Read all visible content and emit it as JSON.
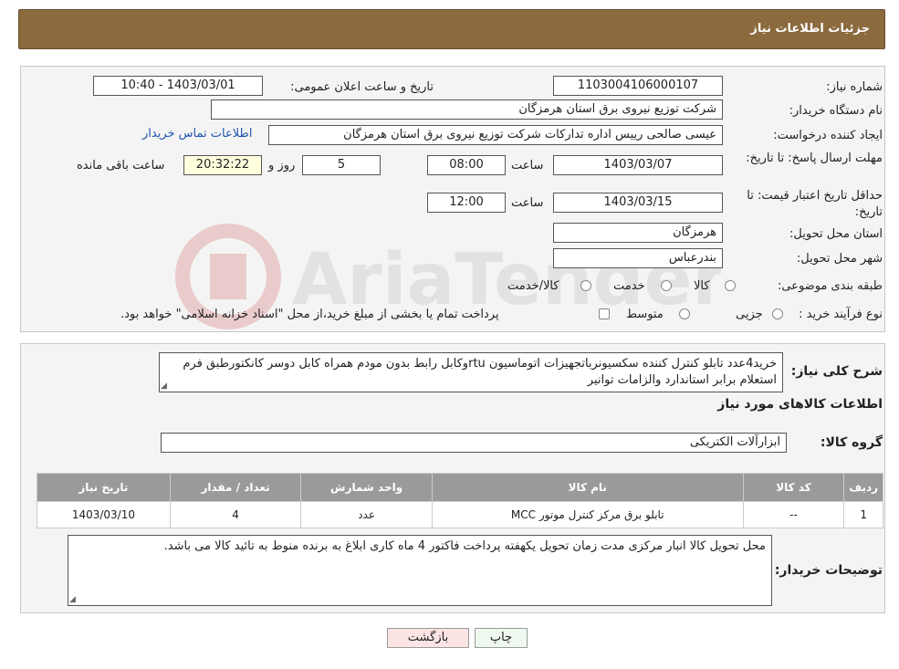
{
  "header": {
    "title": "جزئیات اطلاعات نیاز"
  },
  "form": {
    "need_number": {
      "label": "شماره نیاز:",
      "value": "1103004106000107"
    },
    "announce_datetime": {
      "label": "تاریخ و ساعت اعلان عمومی:",
      "value": "1403/03/01 - 10:40"
    },
    "buyer_org": {
      "label": "نام دستگاه خریدار:",
      "value": "شرکت توزیع نیروی برق استان هرمزگان"
    },
    "requester": {
      "label": "ایجاد کننده درخواست:",
      "value": "عیسی صالحی  رییس اداره تدارکات شرکت توزیع نیروی برق استان هرمزگان",
      "contact_link": "اطلاعات تماس خریدار"
    },
    "deadline": {
      "label": "مهلت ارسال پاسخ: تا تاریخ:",
      "date": "1403/03/07",
      "time_label": "ساعت",
      "time": "08:00",
      "days": "5",
      "days_label": "روز و",
      "remaining": "20:32:22",
      "remaining_label": "ساعت باقی مانده"
    },
    "validity": {
      "label": "حداقل تاریخ اعتبار قیمت: تا تاریخ:",
      "date": "1403/03/15",
      "time_label": "ساعت",
      "time": "12:00"
    },
    "province": {
      "label": "استان محل تحویل:",
      "value": "هرمزگان"
    },
    "city": {
      "label": "شهر محل تحویل:",
      "value": "بندرعباس"
    },
    "category": {
      "label": "طبقه بندی موضوعی:",
      "options": [
        "کالا",
        "خدمت",
        "کالا/خدمت"
      ]
    },
    "process": {
      "label": "نوع فرآیند خرید :",
      "options": [
        "جزیی",
        "متوسط"
      ],
      "note": "پرداخت تمام یا بخشی از مبلغ خرید،از محل \"اسناد خزانه اسلامی\" خواهد بود."
    }
  },
  "description": {
    "label": "شرح کلی نیاز:",
    "text": "خرید4عدد تابلو کنترل کننده سکسیونرباتجهیزات اتوماسیون rtuوکابل رابط بدون مودم همراه کابل دوسر کانکتورطبق فرم استعلام برابر استاندارد والزامات توانیر"
  },
  "goods": {
    "section_title": "اطلاعات کالاهای مورد نیاز",
    "group_label": "گروه کالا:",
    "group_value": "ابزارآلات الکتریکی",
    "columns": [
      "ردیف",
      "کد کالا",
      "نام کالا",
      "واحد شمارش",
      "تعداد / مقدار",
      "تاریخ نیاز"
    ],
    "rows": [
      [
        "1",
        "--",
        "تابلو برق مرکز کنترل موتور MCC",
        "عدد",
        "4",
        "1403/03/10"
      ]
    ]
  },
  "buyer_notes": {
    "label": "توضیحات خریدار:",
    "text": "محل تحویل کالا انبار مرکزی مدت زمان تحویل یکهفته پرداخت فاکتور 4 ماه کاری ابلاغ به برنده منوط به تائید کالا می باشد."
  },
  "buttons": {
    "print": "چاپ",
    "back": "بازگشت"
  },
  "watermark": {
    "text": "AriaTender.neT"
  }
}
